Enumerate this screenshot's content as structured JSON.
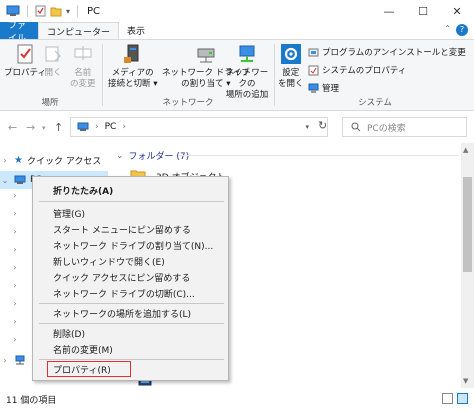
{
  "window": {
    "title": "PC",
    "controls": {
      "minimize": "—",
      "maximize": "☐",
      "close": "✕"
    }
  },
  "tabs": [
    {
      "label": "ファイル"
    },
    {
      "label": "コンピューター"
    },
    {
      "label": "表示"
    }
  ],
  "ribbon": {
    "groups": {
      "location": {
        "label": "場所",
        "buttons": [
          {
            "label": "プロパティ"
          },
          {
            "label": "開く"
          },
          {
            "label_line1": "名前",
            "label_line2": "の変更"
          }
        ]
      },
      "network": {
        "label": "ネットワーク",
        "buttons": [
          {
            "label_line1": "メディアの",
            "label_line2": "接続と切断 ▾"
          },
          {
            "label_line1": "ネットワーク ドライブ",
            "label_line2": "の割り当て ▾"
          },
          {
            "label_line1": "ネットワークの",
            "label_line2": "場所の追加"
          }
        ]
      },
      "system": {
        "label": "システム",
        "open_settings": {
          "label_line1": "設定",
          "label_line2": "を開く"
        },
        "items": [
          {
            "label": "プログラムのアンインストールと変更"
          },
          {
            "label": "システムのプロパティ"
          },
          {
            "label": "管理"
          }
        ]
      }
    },
    "collapse": "ˆ",
    "help": "?"
  },
  "address": {
    "path": "PC",
    "separator": "›",
    "search_placeholder": "PCの検索"
  },
  "navpane": {
    "items": [
      {
        "label": "クイック アクセス"
      },
      {
        "label": "PC"
      }
    ]
  },
  "content": {
    "group_header": "フォルダー (7)",
    "items": [
      {
        "label": "3D オブジェクト"
      }
    ]
  },
  "context_menu": {
    "items": [
      {
        "label": "折りたたみ(A)"
      },
      {
        "label": "管理(G)"
      },
      {
        "label": "スタート メニューにピン留めする"
      },
      {
        "label": "ネットワーク ドライブの割り当て(N)..."
      },
      {
        "label": "新しいウィンドウで開く(E)"
      },
      {
        "label": "クイック アクセスにピン留めする"
      },
      {
        "label": "ネットワーク ドライブの切断(C)..."
      },
      {
        "label": "ネットワークの場所を追加する(L)"
      },
      {
        "label": "削除(D)"
      },
      {
        "label": "名前の変更(M)"
      },
      {
        "label": "プロパティ(R)"
      }
    ]
  },
  "status": {
    "count": "11 個の項目"
  },
  "colors": {
    "accent": "#1979ca",
    "selection": "#cce8ff",
    "highlight_box": "#e0312f"
  }
}
